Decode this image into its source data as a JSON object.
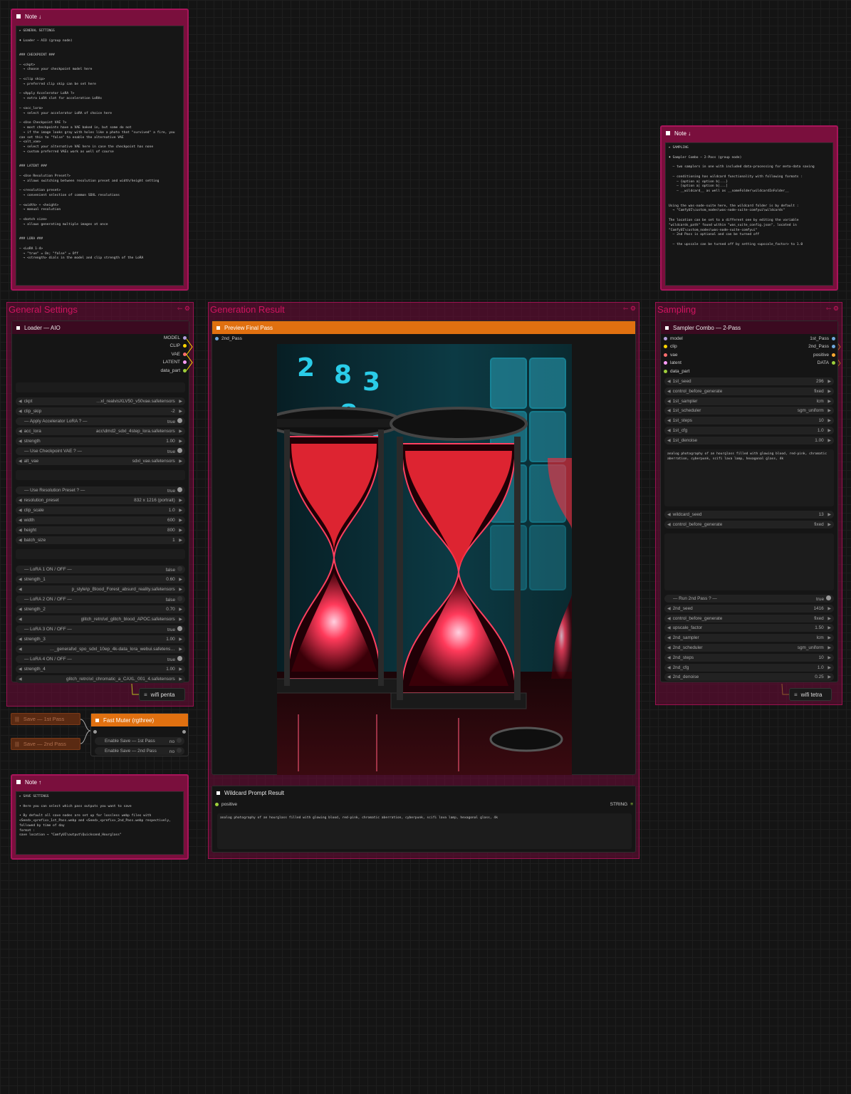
{
  "notes": {
    "general": {
      "title": "Note ↓",
      "text": "▸ GENERAL SETTINGS\n\n♦ Loader — AIO (group node)\n\n\n### CHECKPOINT ###\n\n– <ckpt>\n  → choose your checkpoint model here\n\n– <clip skip>\n  → preferred clip skip can be set here\n\n– <Apply Accelerator LoRA ?>\n  → extra LoRA slot for acceleration LoRAs\n\n– <acc_lora>\n  → select your accelerator LoRA of choice here\n\n– <Use Checkpoint VAE ?>\n  → most checkpoints have a VAE baked in, but some do not\n  → if the image looks gray with holes like a photo that \"survived\" a fire, you\ncan set this to \"false\" to enable the alternative VAE\n– <alt_vae>\n  → select your alternative VAE here in case the checkpoint has none\n  → custom preferred VAEs work as well of course\n\n\n### LATENT ###\n\n– <Use Resolution Preset?>\n  → allows switching between resolution preset and width/height setting\n\n– <resolution preset>\n  → convenient selection of common SDXL resolutions\n\n– <width> + <height>\n  → manual resolution\n\n– <batch size>\n  → allows generating multiple images at once\n\n\n### LORA ###\n\n– <LoRA 1-4>\n  → \"true\" = On; \"false\" = Off\n  → <strength> dials in the model and clip strength of the LoRA"
    },
    "sampling": {
      "title": "Note ↓",
      "text": "▸ SAMPLING\n\n♦ Sampler Combo — 2-Pass (group node)\n\n  – two samplers in one with included data-processing for meta-data saving\n\n  – conditioning has wildcard functionality with following formats :\n    – {option a| option b|...}\n    – [option a| option b|...]\n    – __wildcard__ as well as __someFolder\\wildcardInFolder__\n\n\nUsing the was-node-suite here, the wildcard folder is by default :\n  → \"ComfyUI\\custom_nodes\\was-node-suite-comfyui\\wildcards\"\n\nThe location can be set to a different one by editing the variable\n\"wildcards_path\" found within \"was_suite_config.json\", located in\n\"ComfyUI\\custom_nodes\\was-node-suite-comfyui\"\n  – 2nd Pass is optional and can be turned off\n\n  – the upscale can be turned off by setting <upscale_factor> to 1.0"
    },
    "save": {
      "title": "Note ↑",
      "text": "▸ SAVE SETTINGS\n\n• Here you can select which pass outputs you want to save\n\n• By default all save nodes are set up for lossless webp files with\n<Seed>_<prefix>_1st_Pass.webp and <Seed>_<prefix>_2nd_Pass.webp respectively, followed by time of day\nformat :\nsave location → \"ComfyUI\\output\\Quicksand_Hourglass\""
    }
  },
  "groups": {
    "general": "General Settings",
    "generation": "Generation Result",
    "sampling": "Sampling",
    "icons": "⇽ ⚙"
  },
  "loader": {
    "title": "Loader — AIO",
    "outputs": [
      "MODEL",
      "CLIP",
      "VAE",
      "LATENT",
      "data_part"
    ],
    "widgets": [
      {
        "k": "ckpt",
        "v": "…xl_realvisXLV50_v50vae.safetensors"
      },
      {
        "k": "clip_skip",
        "v": "-2"
      },
      {
        "k": "— Apply Accelerator LoRA ? —",
        "v": "true",
        "t": "on"
      },
      {
        "k": "acc_lora",
        "v": "acc\\dmd2_sdxl_4step_lora.safetensors"
      },
      {
        "k": "strength",
        "v": "1.00"
      },
      {
        "k": "— Use Checkpoint VAE ? —",
        "v": "true",
        "t": "on"
      },
      {
        "k": "alt_vae",
        "v": "sdxl_vae.safetensors"
      },
      {
        "k": "— Use Resolution Preset ? —",
        "v": "true",
        "t": "on"
      },
      {
        "k": "resolution_preset",
        "v": "832 x 1216  (portrait)"
      },
      {
        "k": "clip_scale",
        "v": "1.0"
      },
      {
        "k": "width",
        "v": "600"
      },
      {
        "k": "height",
        "v": "800"
      },
      {
        "k": "batch_size",
        "v": "1"
      },
      {
        "k": "— LoRA 1 ON / OFF —",
        "v": "false",
        "t": "off"
      },
      {
        "k": "strength_1",
        "v": "0.60"
      },
      {
        "k": "",
        "v": "p_style\\p_Blood_Forest_absurd_reality.safetensors"
      },
      {
        "k": "— LoRA 2 ON / OFF —",
        "v": "false",
        "t": "off"
      },
      {
        "k": "strength_2",
        "v": "0.70"
      },
      {
        "k": "",
        "v": "glitch_retro\\xl_glitch_blood_APOC.safetensors"
      },
      {
        "k": "— LoRA 3 ON / OFF —",
        "v": "true",
        "t": "on"
      },
      {
        "k": "strength_3",
        "v": "1.00"
      },
      {
        "k": "",
        "v": "…_general\\xl_spo_sdxl_10ep_4k-data_lora_webui.safetens…"
      },
      {
        "k": "— LoRA 4 ON / OFF —",
        "v": "true",
        "t": "on"
      },
      {
        "k": "strength_4",
        "v": "1.00"
      },
      {
        "k": "",
        "v": "glitch_retro\\xl_chromatic_a_CAXL_001_4.safetensors"
      }
    ]
  },
  "reroutes": {
    "penta": "wifi penta",
    "tetra": "wifi tetra",
    "icon": "≡"
  },
  "save": {
    "first": "Save — 1st Pass",
    "second": "Save — 2nd Pass",
    "icon": "|||"
  },
  "muter": {
    "title": "Fast Muter (rgthree)",
    "toggles": [
      {
        "k": "Enable Save — 1st Pass",
        "v": "no"
      },
      {
        "k": "Enable Save — 2nd Pass",
        "v": "no"
      }
    ]
  },
  "preview": {
    "title": "Preview Final Pass",
    "input": "2nd_Pass",
    "digits": [
      "2",
      "8",
      "3",
      "8",
      "3"
    ]
  },
  "wildcard": {
    "title": "Wildcard Prompt Result",
    "input": "positive",
    "type": "STRING",
    "text": "analog photography of an hourglass filled with glowing blood, red-pink, chromatic aberration, cyberpunk, scifi lava lamp, hexagonal glass, 4k"
  },
  "sampler": {
    "title": "Sampler Combo — 2-Pass",
    "inputs": [
      "model",
      "clip",
      "vae",
      "latent",
      "data_part"
    ],
    "outputs": [
      "1st_Pass",
      "2nd_Pass",
      "positive",
      "DATA"
    ],
    "widgets1": [
      {
        "k": "1st_seed",
        "v": "296"
      },
      {
        "k": "control_before_generate",
        "v": "fixed"
      },
      {
        "k": "1st_sampler",
        "v": "lcm"
      },
      {
        "k": "1st_scheduler",
        "v": "sgm_uniform"
      },
      {
        "k": "1st_steps",
        "v": "10"
      },
      {
        "k": "1st_cfg",
        "v": "1.0"
      },
      {
        "k": "1st_denoise",
        "v": "1.00"
      }
    ],
    "prompt": "analog photography of an hourglass filled with glowing blood, red-pink, chromatic aberration, cyberpunk, scifi lava lamp, hexagonal glass, 4k",
    "widgets2": [
      {
        "k": "wildcard_seed",
        "v": "13"
      },
      {
        "k": "control_before_generate",
        "v": "fixed"
      }
    ],
    "widgets3": [
      {
        "k": "— Run 2nd Pass ? —",
        "v": "true",
        "t": "on"
      },
      {
        "k": "2nd_seed",
        "v": "1416"
      },
      {
        "k": "control_before_generate",
        "v": "fixed"
      },
      {
        "k": "upscale_factor",
        "v": "1.50"
      },
      {
        "k": "2nd_sampler",
        "v": "lcm"
      },
      {
        "k": "2nd_scheduler",
        "v": "sgm_uniform"
      },
      {
        "k": "2nd_steps",
        "v": "10"
      },
      {
        "k": "2nd_cfg",
        "v": "1.0"
      },
      {
        "k": "2nd_denoise",
        "v": "0.25"
      }
    ]
  },
  "colors": {
    "group": "#9a1250",
    "muter": "#e07010",
    "slot_model": "#b39ddb",
    "slot_clip": "#ffd500",
    "slot_vae": "#ff6e6e",
    "slot_latent": "#ff9cf9",
    "slot_data": "#9ecf3b"
  }
}
